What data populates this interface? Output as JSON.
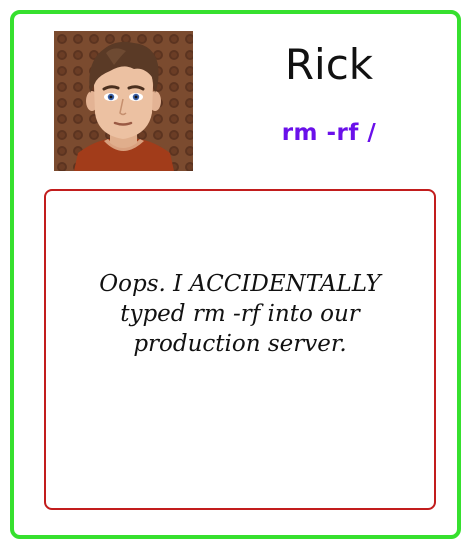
{
  "profile": {
    "name": "Rick",
    "command": "rm -rf /"
  },
  "message": {
    "line1": "Oops. I ACCIDENTALLY",
    "line2": "typed rm -rf into our",
    "line3": "production server."
  },
  "colors": {
    "card_border": "#36e02e",
    "command_text": "#6a10ea",
    "message_border": "#c21d1d",
    "avatar_background": "#7a4a30"
  },
  "icons": {
    "avatar": "cartoon-man-avatar"
  }
}
